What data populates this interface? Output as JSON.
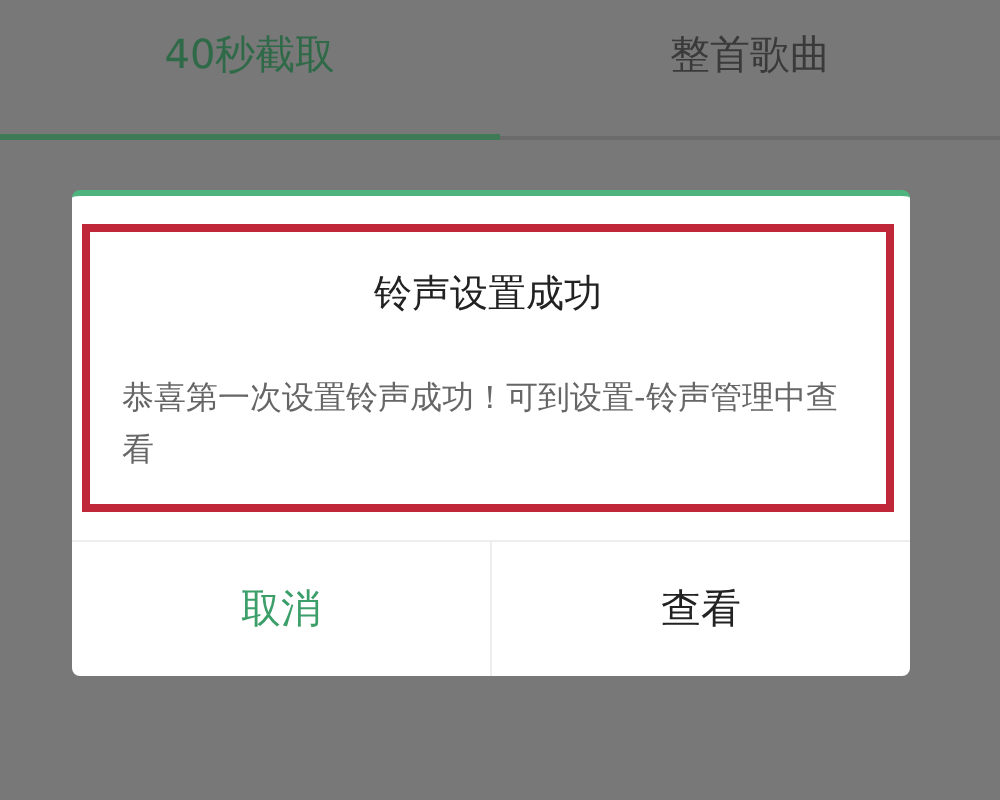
{
  "tabs": [
    {
      "label": "40秒截取",
      "selected": true
    },
    {
      "label": "整首歌曲",
      "selected": false
    }
  ],
  "dialog": {
    "title": "铃声设置成功",
    "message": "恭喜第一次设置铃声成功！可到设置-铃声管理中查看",
    "highlighted": true,
    "buttons": [
      {
        "label": "取消",
        "kind": "accent"
      },
      {
        "label": "查看",
        "kind": "plain"
      }
    ]
  }
}
